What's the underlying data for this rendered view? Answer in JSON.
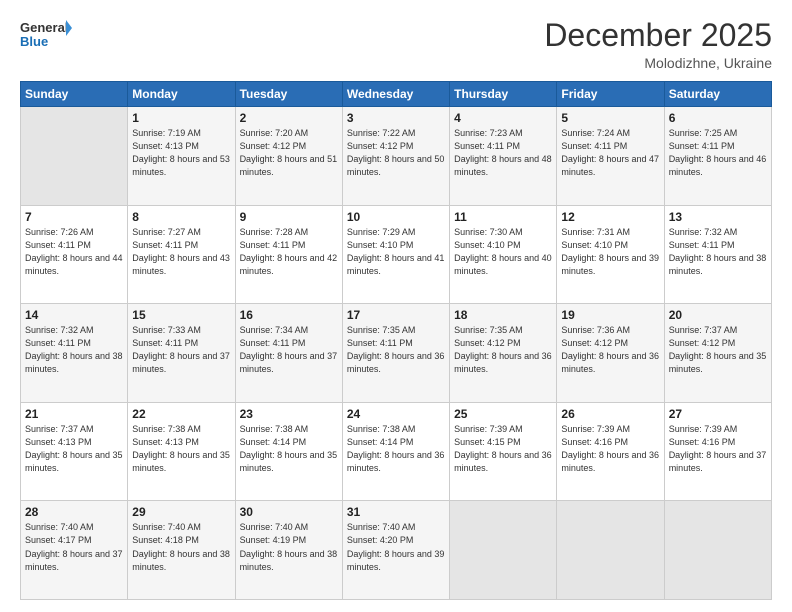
{
  "header": {
    "logo_line1": "General",
    "logo_line2": "Blue",
    "month": "December 2025",
    "location": "Molodizhne, Ukraine"
  },
  "weekdays": [
    "Sunday",
    "Monday",
    "Tuesday",
    "Wednesday",
    "Thursday",
    "Friday",
    "Saturday"
  ],
  "weeks": [
    [
      {
        "day": "",
        "info": ""
      },
      {
        "day": "1",
        "info": "Sunrise: 7:19 AM\nSunset: 4:13 PM\nDaylight: 8 hours\nand 53 minutes."
      },
      {
        "day": "2",
        "info": "Sunrise: 7:20 AM\nSunset: 4:12 PM\nDaylight: 8 hours\nand 51 minutes."
      },
      {
        "day": "3",
        "info": "Sunrise: 7:22 AM\nSunset: 4:12 PM\nDaylight: 8 hours\nand 50 minutes."
      },
      {
        "day": "4",
        "info": "Sunrise: 7:23 AM\nSunset: 4:11 PM\nDaylight: 8 hours\nand 48 minutes."
      },
      {
        "day": "5",
        "info": "Sunrise: 7:24 AM\nSunset: 4:11 PM\nDaylight: 8 hours\nand 47 minutes."
      },
      {
        "day": "6",
        "info": "Sunrise: 7:25 AM\nSunset: 4:11 PM\nDaylight: 8 hours\nand 46 minutes."
      }
    ],
    [
      {
        "day": "7",
        "info": "Sunrise: 7:26 AM\nSunset: 4:11 PM\nDaylight: 8 hours\nand 44 minutes."
      },
      {
        "day": "8",
        "info": "Sunrise: 7:27 AM\nSunset: 4:11 PM\nDaylight: 8 hours\nand 43 minutes."
      },
      {
        "day": "9",
        "info": "Sunrise: 7:28 AM\nSunset: 4:11 PM\nDaylight: 8 hours\nand 42 minutes."
      },
      {
        "day": "10",
        "info": "Sunrise: 7:29 AM\nSunset: 4:10 PM\nDaylight: 8 hours\nand 41 minutes."
      },
      {
        "day": "11",
        "info": "Sunrise: 7:30 AM\nSunset: 4:10 PM\nDaylight: 8 hours\nand 40 minutes."
      },
      {
        "day": "12",
        "info": "Sunrise: 7:31 AM\nSunset: 4:10 PM\nDaylight: 8 hours\nand 39 minutes."
      },
      {
        "day": "13",
        "info": "Sunrise: 7:32 AM\nSunset: 4:11 PM\nDaylight: 8 hours\nand 38 minutes."
      }
    ],
    [
      {
        "day": "14",
        "info": "Sunrise: 7:32 AM\nSunset: 4:11 PM\nDaylight: 8 hours\nand 38 minutes."
      },
      {
        "day": "15",
        "info": "Sunrise: 7:33 AM\nSunset: 4:11 PM\nDaylight: 8 hours\nand 37 minutes."
      },
      {
        "day": "16",
        "info": "Sunrise: 7:34 AM\nSunset: 4:11 PM\nDaylight: 8 hours\nand 37 minutes."
      },
      {
        "day": "17",
        "info": "Sunrise: 7:35 AM\nSunset: 4:11 PM\nDaylight: 8 hours\nand 36 minutes."
      },
      {
        "day": "18",
        "info": "Sunrise: 7:35 AM\nSunset: 4:12 PM\nDaylight: 8 hours\nand 36 minutes."
      },
      {
        "day": "19",
        "info": "Sunrise: 7:36 AM\nSunset: 4:12 PM\nDaylight: 8 hours\nand 36 minutes."
      },
      {
        "day": "20",
        "info": "Sunrise: 7:37 AM\nSunset: 4:12 PM\nDaylight: 8 hours\nand 35 minutes."
      }
    ],
    [
      {
        "day": "21",
        "info": "Sunrise: 7:37 AM\nSunset: 4:13 PM\nDaylight: 8 hours\nand 35 minutes."
      },
      {
        "day": "22",
        "info": "Sunrise: 7:38 AM\nSunset: 4:13 PM\nDaylight: 8 hours\nand 35 minutes."
      },
      {
        "day": "23",
        "info": "Sunrise: 7:38 AM\nSunset: 4:14 PM\nDaylight: 8 hours\nand 35 minutes."
      },
      {
        "day": "24",
        "info": "Sunrise: 7:38 AM\nSunset: 4:14 PM\nDaylight: 8 hours\nand 36 minutes."
      },
      {
        "day": "25",
        "info": "Sunrise: 7:39 AM\nSunset: 4:15 PM\nDaylight: 8 hours\nand 36 minutes."
      },
      {
        "day": "26",
        "info": "Sunrise: 7:39 AM\nSunset: 4:16 PM\nDaylight: 8 hours\nand 36 minutes."
      },
      {
        "day": "27",
        "info": "Sunrise: 7:39 AM\nSunset: 4:16 PM\nDaylight: 8 hours\nand 37 minutes."
      }
    ],
    [
      {
        "day": "28",
        "info": "Sunrise: 7:40 AM\nSunset: 4:17 PM\nDaylight: 8 hours\nand 37 minutes."
      },
      {
        "day": "29",
        "info": "Sunrise: 7:40 AM\nSunset: 4:18 PM\nDaylight: 8 hours\nand 38 minutes."
      },
      {
        "day": "30",
        "info": "Sunrise: 7:40 AM\nSunset: 4:19 PM\nDaylight: 8 hours\nand 38 minutes."
      },
      {
        "day": "31",
        "info": "Sunrise: 7:40 AM\nSunset: 4:20 PM\nDaylight: 8 hours\nand 39 minutes."
      },
      {
        "day": "",
        "info": ""
      },
      {
        "day": "",
        "info": ""
      },
      {
        "day": "",
        "info": ""
      }
    ]
  ]
}
